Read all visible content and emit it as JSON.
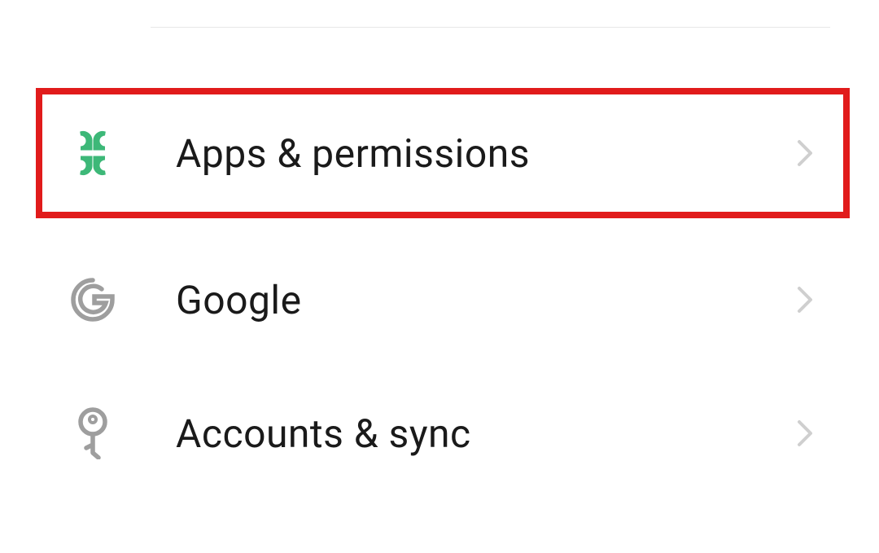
{
  "settings": {
    "items": [
      {
        "label": "Apps & permissions",
        "icon": "apps-icon",
        "highlighted": true
      },
      {
        "label": "Google",
        "icon": "google-icon",
        "highlighted": false
      },
      {
        "label": "Accounts & sync",
        "icon": "key-icon",
        "highlighted": false
      }
    ]
  },
  "colors": {
    "accent_green": "#3db878",
    "gray_icon": "#9e9e9e",
    "chevron": "#cfcfcf",
    "highlight_border": "#e11b1b"
  }
}
